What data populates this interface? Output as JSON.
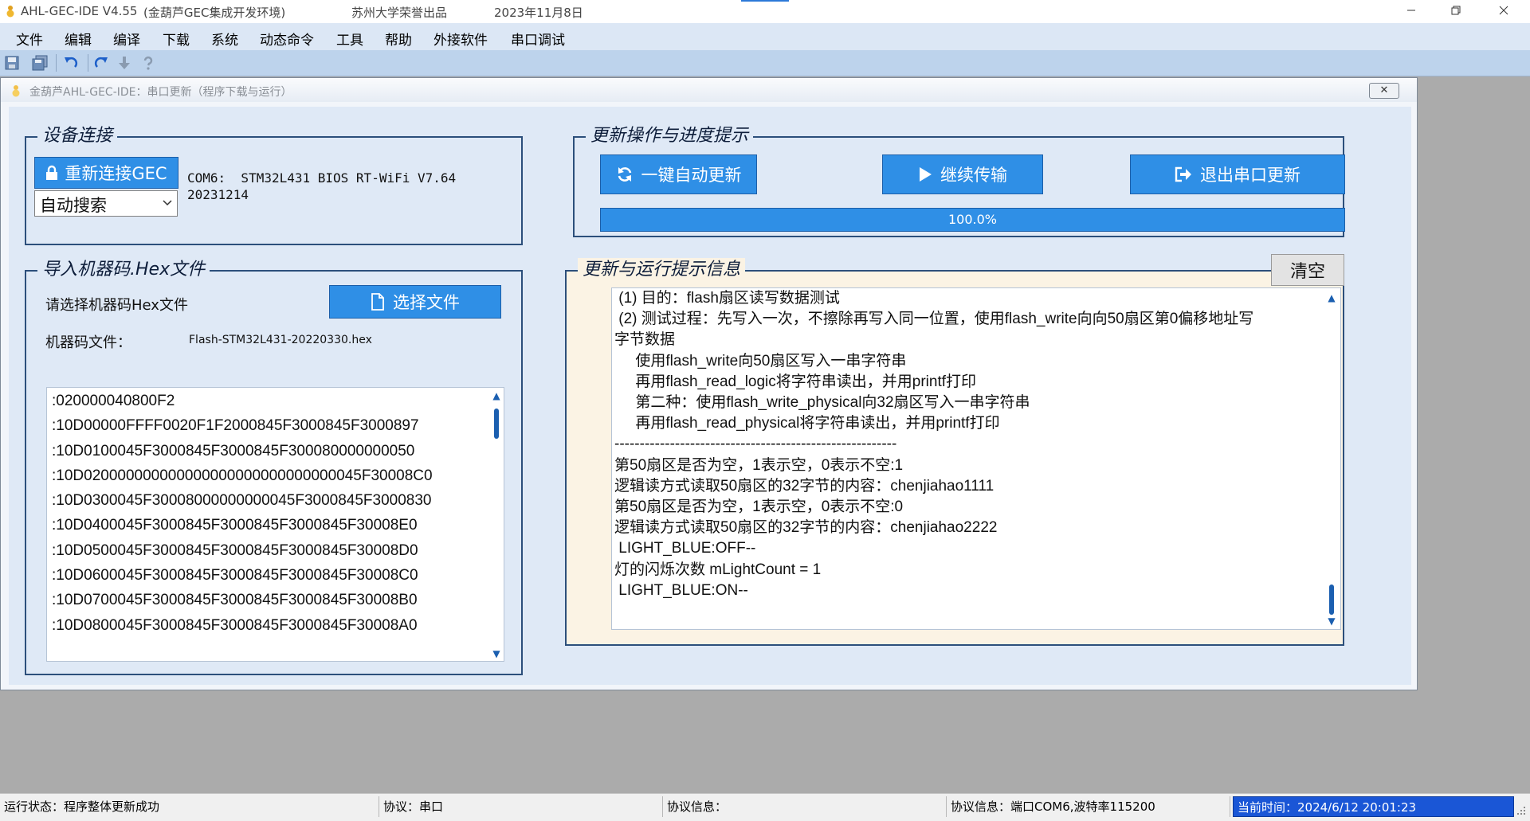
{
  "window": {
    "title": "AHL-GEC-IDE V4.55",
    "subtitle": "(金葫芦GEC集成开发环境)",
    "org": "苏州大学荣誉出品",
    "date": "2023年11月8日",
    "icons": {
      "minimize": "minimize-icon",
      "restore": "restore-icon",
      "close": "close-icon"
    }
  },
  "menu": {
    "items": [
      "文件",
      "编辑",
      "编译",
      "下载",
      "系统",
      "动态命令",
      "工具",
      "帮助",
      "外接软件",
      "串口调试"
    ]
  },
  "toolbar": {
    "icons": [
      "save-icon",
      "save-all-icon",
      "undo-icon",
      "redo-icon",
      "download-icon",
      "help-icon"
    ]
  },
  "dialog": {
    "title": "金葫芦AHL-GEC-IDE：串口更新（程序下载与运行）",
    "close_label": "✕",
    "device": {
      "legend": "设备连接",
      "reconnect_label": "重新连接GEC",
      "info_line1": "COM6:  STM32L431 BIOS RT-WiFi V7.64",
      "info_line2": "20231214",
      "search_select": "自动搜索"
    },
    "import": {
      "legend": "导入机器码.Hex文件",
      "prompt": "请选择机器码Hex文件",
      "choose_label": "选择文件",
      "file_label": "机器码文件：",
      "file_name": "Flash-STM32L431-20220330.hex",
      "hex_lines": [
        ":020000040800F2",
        ":10D00000FFFF0020F1F2000845F3000845F3000897",
        ":10D0100045F3000845F3000845F300080000000050",
        ":10D020000000000000000000000000000045F30008C0",
        ":10D0300045F30008000000000045F3000845F3000830",
        ":10D0400045F3000845F3000845F3000845F30008E0",
        ":10D0500045F3000845F3000845F3000845F30008D0",
        ":10D0600045F3000845F3000845F3000845F30008C0",
        ":10D0700045F3000845F3000845F3000845F30008B0",
        ":10D0800045F3000845F3000845F3000845F30008A0"
      ]
    },
    "update": {
      "legend": "更新操作与进度提示",
      "auto_label": "一键自动更新",
      "continue_label": "继续传输",
      "exit_label": "退出串口更新",
      "progress_text": "100.0%",
      "progress_value": 1.0
    },
    "info": {
      "legend": "更新与运行提示信息",
      "clear_label": "清空",
      "log_lines": [
        " (1) 目的：flash扇区读写数据测试",
        " (2) 测试过程：先写入一次，不擦除再写入同一位置，使用flash_write向向50扇区第0偏移地址写",
        "字节数据",
        "     使用flash_write向50扇区写入一串字符串",
        "     再用flash_read_logic将字符串读出，并用printf打印",
        "     第二种：使用flash_write_physical向32扇区写入一串字符串",
        "     再用flash_read_physical将字符串读出，并用printf打印",
        "--------------------------------------------------------",
        "第50扇区是否为空，1表示空，0表示不空:1",
        "逻辑读方式读取50扇区的32字节的内容：chenjiahao1111",
        "第50扇区是否为空，1表示空，0表示不空:0",
        "逻辑读方式读取50扇区的32字节的内容：chenjiahao2222",
        " LIGHT_BLUE:OFF--",
        "灯的闪烁次数 mLightCount = 1",
        " LIGHT_BLUE:ON--"
      ]
    }
  },
  "status": {
    "run_state": "运行状态：程序整体更新成功",
    "protocol": "协议：串口",
    "protocol_info_empty": "协议信息：",
    "protocol_info": "协议信息：端口COM6,波特率115200",
    "time": "当前时间：2024/6/12 20:01:23"
  },
  "colors": {
    "accent": "#2f8fe6",
    "panel": "#dfe9f6",
    "group_border": "#2c4f7b",
    "time_bg": "#1a56d6"
  }
}
